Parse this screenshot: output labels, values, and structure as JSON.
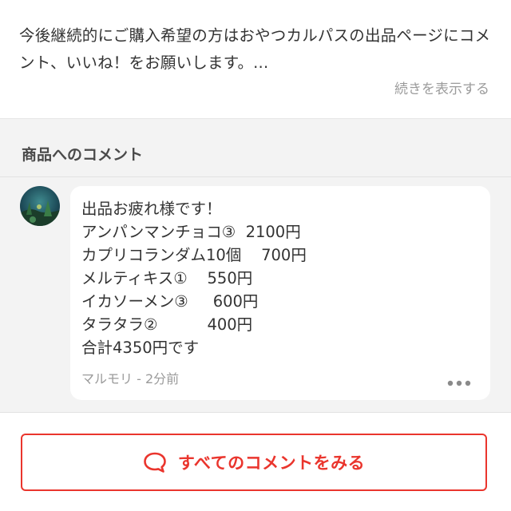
{
  "description": {
    "text": "今後継続的にご購入希望の方はおやつカルパスの出品ページにコメント、いいね！をお願いします。...",
    "show_more": "続きを表示する"
  },
  "comments": {
    "title": "商品へのコメント",
    "items": [
      {
        "lines": [
          "出品お疲れ様です！",
          "アンパンマンチョコ③  2100円",
          "カプリコランダム10個    700円",
          "メルティキス①    550円",
          "イカソーメン③     600円",
          "タラタラ②          400円",
          "合計4350円です"
        ],
        "author_time": "マルモリ - 2分前",
        "more_icon": "ellipsis-icon"
      }
    ]
  },
  "footer": {
    "all_comments_label": "すべてのコメントをみる",
    "icon": "speech-bubble-icon"
  },
  "colors": {
    "accent": "#ea352d",
    "section_bg": "#f3f3f3",
    "muted_text": "#9b9b9b"
  }
}
